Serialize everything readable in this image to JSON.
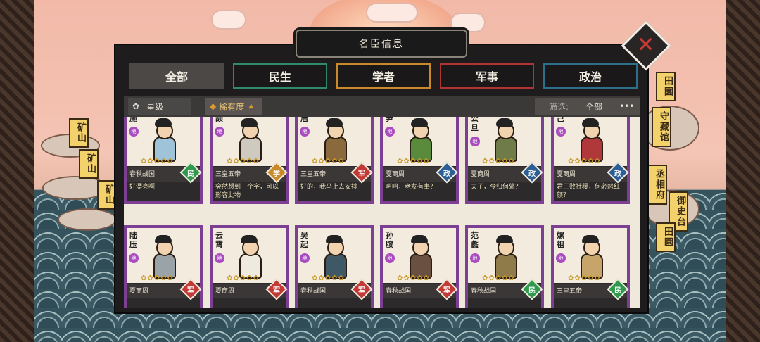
{
  "title": "名臣信息",
  "close_label": "✕",
  "tabs": [
    {
      "label": "全部",
      "active": true,
      "color": "#4b4846"
    },
    {
      "label": "民生",
      "active": false,
      "color": "#2f8a6b"
    },
    {
      "label": "学者",
      "active": false,
      "color": "#c98a2a"
    },
    {
      "label": "军事",
      "active": false,
      "color": "#b03532"
    },
    {
      "label": "政治",
      "active": false,
      "color": "#2b6f8a"
    }
  ],
  "sort": {
    "star_label": "星级",
    "rarity_label": "稀有度",
    "filter_label": "筛选:",
    "filter_value": "全部",
    "more_label": "•••"
  },
  "map_signs": [
    "矿山",
    "矿山",
    "矿山",
    "田園",
    "守藏馆",
    "丞相府",
    "御史台",
    "田園"
  ],
  "department_colors": {
    "民": "#2f9a4e",
    "学": "#c98a2a",
    "军": "#c23a36",
    "政": "#2b5f95"
  },
  "cards": [
    {
      "name": "施",
      "rank": "地",
      "stars": "✿✿✿✿✿",
      "era": "春秋战国",
      "dept": "民",
      "quote": "好漂亮啊",
      "robe": "#9fc3d8"
    },
    {
      "name": "颉",
      "rank": "地",
      "stars": "✿✿✿✿✿",
      "era": "三皇五帝",
      "dept": "学",
      "quote": "突然想到一个字，可以形容此物",
      "robe": "#cfcac0"
    },
    {
      "name": "后",
      "rank": "地",
      "stars": "✿✿✿✿✿",
      "era": "三皇五帝",
      "dept": "军",
      "quote": "好的，我马上去安排",
      "robe": "#8a6a3c"
    },
    {
      "name": "尹",
      "rank": "地",
      "stars": "✿✿✿✿✿",
      "era": "夏商周",
      "dept": "政",
      "quote": "呵呵，老友有事？",
      "robe": "#5a8a3c"
    },
    {
      "name": "公旦",
      "rank": "地",
      "stars": "✿✿✿✿✿",
      "era": "夏商周",
      "dept": "政",
      "quote": "夫子，今归何处？",
      "robe": "#6f7c4a"
    },
    {
      "name": "己",
      "rank": "地",
      "stars": "✿✿✿✿✿",
      "era": "夏商周",
      "dept": "政",
      "quote": "君王败社稷，何必怨红颜？",
      "robe": "#b0383a"
    },
    {
      "name": "陆压",
      "rank": "地",
      "stars": "✿✿✿✿✿",
      "era": "夏商周",
      "dept": "军",
      "quote": "",
      "robe": "#9aa3a8"
    },
    {
      "name": "云霄",
      "rank": "地",
      "stars": "✿✿✿✿✿",
      "era": "夏商周",
      "dept": "军",
      "quote": "",
      "robe": "#efeae0"
    },
    {
      "name": "吴起",
      "rank": "地",
      "stars": "✿✿✿✿✿",
      "era": "春秋战国",
      "dept": "军",
      "quote": "",
      "robe": "#3f5866"
    },
    {
      "name": "孙膑",
      "rank": "地",
      "stars": "✿✿✿✿✿",
      "era": "春秋战国",
      "dept": "军",
      "quote": "",
      "robe": "#6a5040"
    },
    {
      "name": "范蠡",
      "rank": "地",
      "stars": "✿✿✿✿✿",
      "era": "春秋战国",
      "dept": "民",
      "quote": "",
      "robe": "#8f7a4a"
    },
    {
      "name": "嫘祖",
      "rank": "地",
      "stars": "✿✿✿✿✿",
      "era": "三皇五帝",
      "dept": "民",
      "quote": "",
      "robe": "#c7a46a"
    }
  ]
}
